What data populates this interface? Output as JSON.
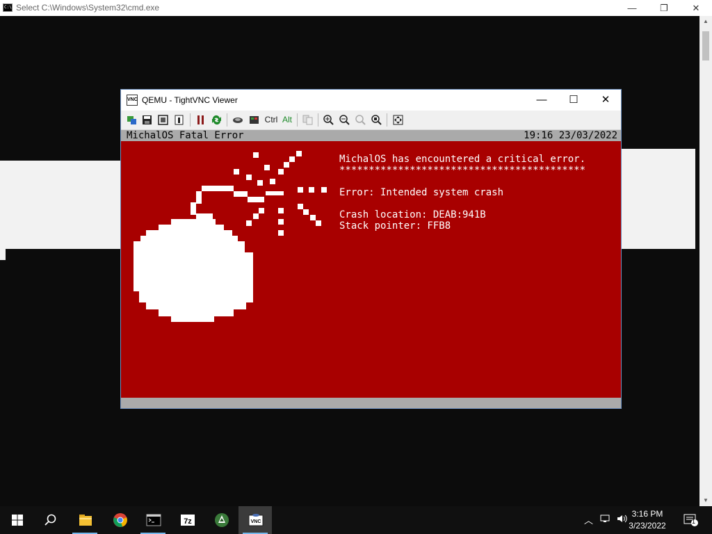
{
  "cmd": {
    "title": "Select C:\\Windows\\System32\\cmd.exe",
    "minimize": "—",
    "restore": "❐",
    "close": "✕"
  },
  "vnc": {
    "title": "QEMU - TightVNC Viewer",
    "minimize": "—",
    "maximize": "☐",
    "close": "✕",
    "toolbar": {
      "ctrl": "Ctrl",
      "alt": "Alt"
    }
  },
  "os": {
    "header_left": "MichalOS Fatal Error",
    "header_right": "19:16 23/03/2022",
    "lines": [
      "MichalOS has encountered a critical error.",
      "******************************************",
      "Error: Intended system crash",
      "Crash location: DEAB:941B",
      "Stack pointer: FFB8"
    ]
  },
  "taskbar": {
    "time": "3:16 PM",
    "date": "3/23/2022",
    "notification_count": "1",
    "apps": [
      "start",
      "search",
      "file-explorer",
      "chrome",
      "cmd",
      "7zip",
      "inkscape",
      "tightvnc"
    ]
  },
  "colors": {
    "crash_bg": "#a80000",
    "os_bar": "#aaaaaa",
    "taskbar": "#101010"
  }
}
